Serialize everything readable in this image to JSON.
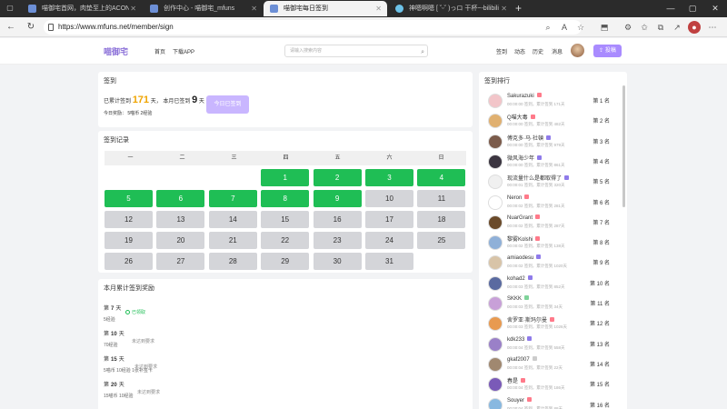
{
  "browser": {
    "tabs": [
      {
        "label": "喵御宅首网，肉垫至上的ACON社"
      },
      {
        "label": "创作中心 - 喵御宅_mfuns"
      },
      {
        "label": "喵御宅每日签到"
      },
      {
        "label": "神嗯啊嗯 [ ˘ᵕ˘ )っロ 干杯~-bilibili"
      }
    ],
    "new_tab": "+",
    "url": "https://www.mfuns.net/member/sign"
  },
  "site": {
    "logo": "喵御宅",
    "nav_home": "首页",
    "nav_download": "下载APP",
    "search_placeholder": "请输入搜索内容",
    "nav_sign": "签到",
    "nav_activity": "动态",
    "nav_history": "历史",
    "nav_messages": "消息",
    "post_button": "投稿"
  },
  "sign": {
    "title": "签到",
    "total_label": "已累计签到",
    "total_days": "171",
    "unit_day": "天，",
    "month_label": "本月已签到",
    "month_days": "9",
    "unit_day2": "天",
    "today_reward": "今日奖励： 5喵币 2经验",
    "button": "今日已签到"
  },
  "calendar": {
    "title": "签到记录",
    "weekdays": [
      "一",
      "二",
      "三",
      "四",
      "五",
      "六",
      "日"
    ],
    "days": [
      {
        "n": "1",
        "signed": true
      },
      {
        "n": "2",
        "signed": true
      },
      {
        "n": "3",
        "signed": true
      },
      {
        "n": "4",
        "signed": true
      },
      {
        "n": "5",
        "signed": true
      },
      {
        "n": "6",
        "signed": true
      },
      {
        "n": "7",
        "signed": true
      },
      {
        "n": "8",
        "signed": true
      },
      {
        "n": "9",
        "signed": true
      },
      {
        "n": "10",
        "signed": false
      },
      {
        "n": "11",
        "signed": false
      },
      {
        "n": "12",
        "signed": false
      },
      {
        "n": "13",
        "signed": false
      },
      {
        "n": "14",
        "signed": false
      },
      {
        "n": "15",
        "signed": false
      },
      {
        "n": "16",
        "signed": false
      },
      {
        "n": "17",
        "signed": false
      },
      {
        "n": "18",
        "signed": false
      },
      {
        "n": "19",
        "signed": false
      },
      {
        "n": "20",
        "signed": false
      },
      {
        "n": "21",
        "signed": false
      },
      {
        "n": "22",
        "signed": false
      },
      {
        "n": "23",
        "signed": false
      },
      {
        "n": "24",
        "signed": false
      },
      {
        "n": "25",
        "signed": false
      },
      {
        "n": "26",
        "signed": false
      },
      {
        "n": "27",
        "signed": false
      },
      {
        "n": "28",
        "signed": false
      },
      {
        "n": "29",
        "signed": false
      },
      {
        "n": "30",
        "signed": false
      },
      {
        "n": "31",
        "signed": false
      }
    ]
  },
  "monthly": {
    "title": "本月累计签到奖励",
    "tiers": [
      {
        "prefix": "第",
        "days": "7",
        "suffix": "天",
        "reward": "5经验",
        "status": "已领取",
        "got": true
      },
      {
        "prefix": "第",
        "days": "10",
        "suffix": "天",
        "reward": "70经验",
        "status": "未达到要求",
        "got": false
      },
      {
        "prefix": "第",
        "days": "15",
        "suffix": "天",
        "reward": "5喵币 10经验 1张补签卡",
        "status": "未达到要求",
        "got": false
      },
      {
        "prefix": "第",
        "days": "20",
        "suffix": "天",
        "reward": "15喵币 10经验",
        "status": "未达到要求",
        "got": false
      }
    ]
  },
  "ranking": {
    "title": "签到排行",
    "rows": [
      {
        "name": "Sakurazuki",
        "sub": "00:00:00 签到，累计签到 171天",
        "rank": "第 1 名",
        "badge": "#ff7a8a",
        "avatar": "#f2c5c9"
      },
      {
        "name": "Q喵大毒",
        "sub": "00:00:00 签到，累计签到 482天",
        "rank": "第 2 名",
        "badge": "#ff7a8a",
        "avatar": "#e0b070"
      },
      {
        "name": "傅克多·马·社頓",
        "sub": "00:00:00 签到，累计签到 979天",
        "rank": "第 3 名",
        "badge": "#8f7bea",
        "avatar": "#7b5b4b"
      },
      {
        "name": "微风海少年",
        "sub": "00:00:00 签到，累计签到 861天",
        "rank": "第 4 名",
        "badge": "#8f7bea",
        "avatar": "#3b3540"
      },
      {
        "name": "现流量什么是都取得了",
        "sub": "00:00:01 签到，累计签到 320天",
        "rank": "第 5 名",
        "badge": "#8f7bea",
        "avatar": "#f0f0f0"
      },
      {
        "name": "Neron",
        "sub": "00:00:02 签到，累计签到 281天",
        "rank": "第 6 名",
        "badge": "#ff7a8a",
        "avatar": "#ffffff"
      },
      {
        "name": "NuarGrant",
        "sub": "00:00:02 签到，累计签到 287天",
        "rank": "第 7 名",
        "badge": "#ff7a8a",
        "avatar": "#6a4a2a"
      },
      {
        "name": "黎雾Kolshi",
        "sub": "00:00:02 签到，累计签到 138天",
        "rank": "第 8 名",
        "badge": "#ff7a8a",
        "avatar": "#8fb0d8"
      },
      {
        "name": "amiaodesu",
        "sub": "00:00:02 签到，累计签到 1020天",
        "rank": "第 9 名",
        "badge": "#8f7bea",
        "avatar": "#d8c4a8"
      },
      {
        "name": "kohad2",
        "sub": "00:00:03 签到，累计签到 852天",
        "rank": "第 10 名",
        "badge": "#8f7bea",
        "avatar": "#5a6aa0"
      },
      {
        "name": "SKKK",
        "sub": "00:00:03 签到，累计签到 34天",
        "rank": "第 11 名",
        "badge": "#7fd39a",
        "avatar": "#c8a0d8"
      },
      {
        "name": "舍罗亚·斯玛尔曼",
        "sub": "00:00:03 签到，累计签到 1026天",
        "rank": "第 12 名",
        "badge": "#ff7a8a",
        "avatar": "#e89a50"
      },
      {
        "name": "kdk233",
        "sub": "00:00:04 签到，累计签到 558天",
        "rank": "第 13 名",
        "badge": "#8f7bea",
        "avatar": "#9a80c8"
      },
      {
        "name": "gkaf2007",
        "sub": "00:00:04 签到，累计签到 22天",
        "rank": "第 14 名",
        "badge": "#cccccc",
        "avatar": "#a08870"
      },
      {
        "name": "春是",
        "sub": "00:00:04 签到，累计签到 186天",
        "rank": "第 15 名",
        "badge": "#ff7a8a",
        "avatar": "#7a5ab8"
      },
      {
        "name": "Souyer",
        "sub": "00:00:04 签到，累计签到 88天",
        "rank": "第 16 名",
        "badge": "#ff7a8a",
        "avatar": "#88b8e0"
      }
    ]
  }
}
